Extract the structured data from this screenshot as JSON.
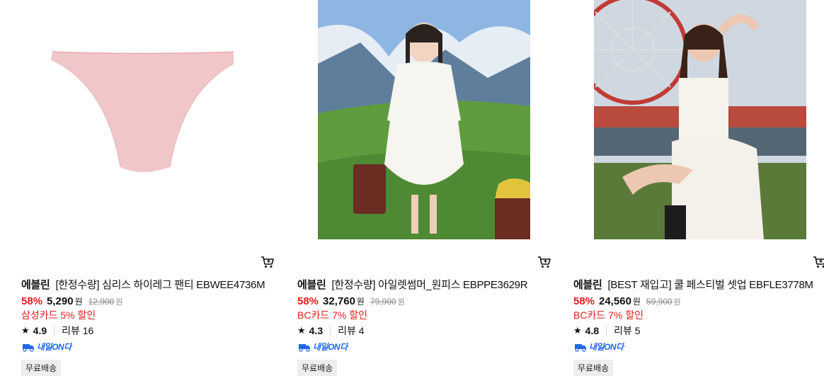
{
  "products": [
    {
      "brand": "에블린",
      "name": "[한정수량] 심리스 하이레그 팬티 EBWEE4736M",
      "discount_rate": "58%",
      "price": "5,290",
      "price_unit": "원",
      "original_price": "12,900",
      "original_unit": "원",
      "card_discount": "삼성카드 5% 할인",
      "rating": "4.9",
      "review_label": "리뷰 16",
      "delivery_badge": "내일ON다",
      "shipping_tag": "무료배송"
    },
    {
      "brand": "에블린",
      "name": "[한정수량] 아일렛썸머_원피스 EBPPE3629R",
      "discount_rate": "58%",
      "price": "32,760",
      "price_unit": "원",
      "original_price": "79,900",
      "original_unit": "원",
      "card_discount": "BC카드 7% 할인",
      "rating": "4.3",
      "review_label": "리뷰 4",
      "delivery_badge": "내일ON다",
      "shipping_tag": "무료배송"
    },
    {
      "brand": "에블린",
      "name": "[BEST 재입고] 쿨 페스티벌 셋업 EBFLE3778M",
      "discount_rate": "58%",
      "price": "24,560",
      "price_unit": "원",
      "original_price": "59,900",
      "original_unit": "원",
      "card_discount": "BC카드 7% 할인",
      "rating": "4.8",
      "review_label": "리뷰 5",
      "delivery_badge": "내일ON다",
      "shipping_tag": "무료배송"
    }
  ],
  "icons": {
    "cart": "cart-icon",
    "star": "star-icon",
    "delivery": "delivery-truck-icon"
  },
  "colors": {
    "discount_red": "#e31b1b",
    "delivery_blue": "#1f67e8",
    "strike_gray": "#8a8a8a"
  }
}
